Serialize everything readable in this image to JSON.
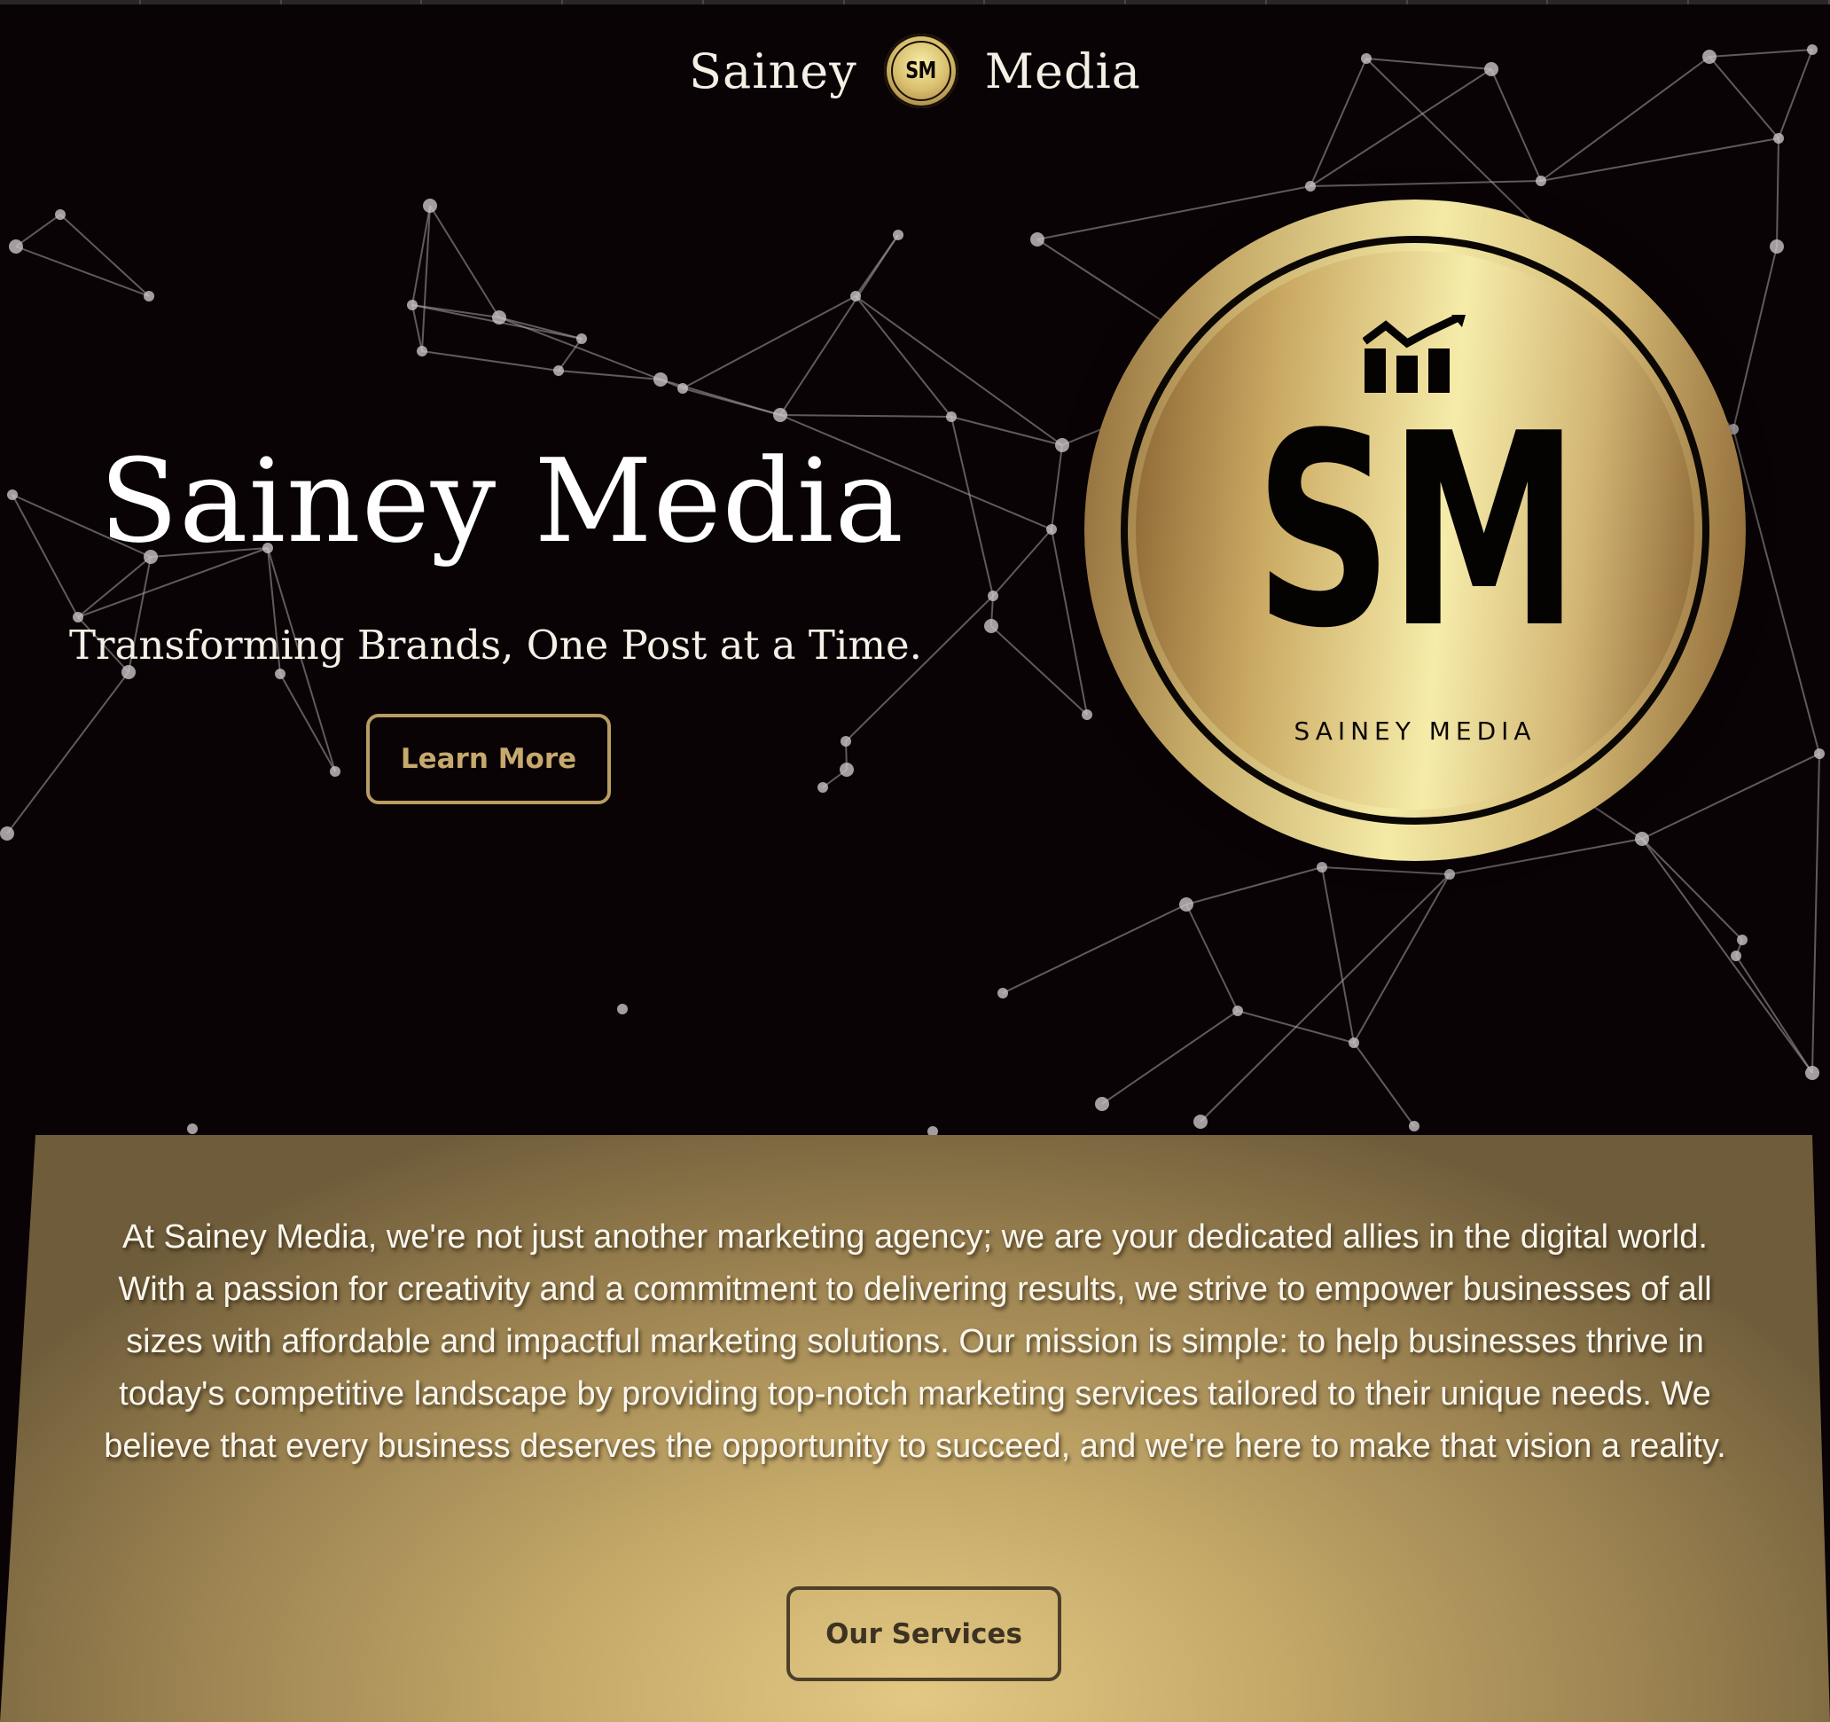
{
  "nav": {
    "brand_left": "Sainey",
    "brand_right": "Media",
    "logo_monogram": "SM",
    "logo_icon": "sm-emblem-icon"
  },
  "hero": {
    "title": "Sainey Media",
    "tagline": "Transforming Brands, One Post at a Time.",
    "cta_label": "Learn More",
    "background_icon": "network-constellation-icon"
  },
  "emblem": {
    "icon": "bar-chart-growth-icon",
    "monogram": "SM",
    "caption": "SAINEY MEDIA"
  },
  "about": {
    "text": "At Sainey Media, we're not just another marketing agency; we are your dedicated allies in the digital world. With a passion for creativity and a commitment to delivering results, we strive to empower businesses of all sizes with affordable and impactful marketing solutions. Our mission is simple: to help businesses thrive in today's competitive landscape by providing top-notch marketing services tailored to their unique needs. We believe that every business deserves the opportunity to succeed, and we're here to make that vision a reality.",
    "cta_label": "Our Services"
  },
  "colors": {
    "background": "#0a0305",
    "gold_accent": "#c7a96e",
    "gold_light": "#f4eaa6",
    "gold_dark": "#8a6433",
    "text_light": "#ffffff"
  }
}
